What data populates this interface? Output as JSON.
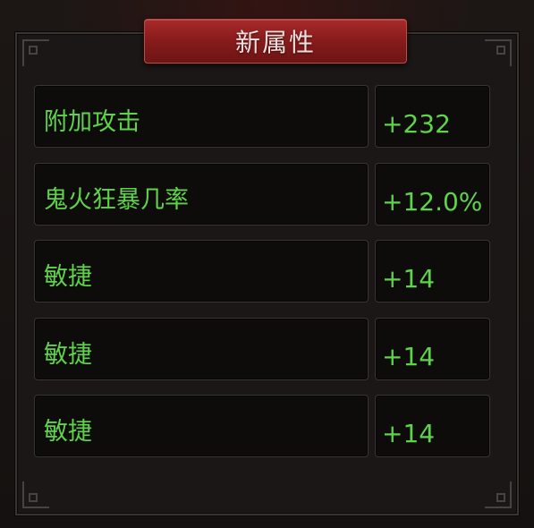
{
  "panel": {
    "title": "新属性"
  },
  "attributes": [
    {
      "name": "附加攻击",
      "value": "+232"
    },
    {
      "name": "鬼火狂暴几率",
      "value": "+12.0%"
    },
    {
      "name": "敏捷",
      "value": "+14"
    },
    {
      "name": "敏捷",
      "value": "+14"
    },
    {
      "name": "敏捷",
      "value": "+14"
    }
  ],
  "colors": {
    "attribute_text": "#5fd34a",
    "title_banner": "#8a1c1c",
    "title_text": "#f1dede"
  }
}
